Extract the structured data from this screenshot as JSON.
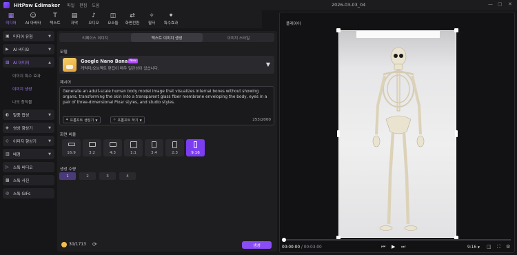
{
  "app": {
    "title": "HitPaw Edimakor",
    "menu": [
      "파일",
      "편집",
      "도움"
    ],
    "datetime": "2026-03-03_04"
  },
  "toolbar": [
    {
      "label": "미디어",
      "icon": "▦",
      "active": true
    },
    {
      "label": "AI 아바타",
      "icon": "☺",
      "active": false
    },
    {
      "label": "텍스트",
      "icon": "T",
      "active": false
    },
    {
      "label": "자막",
      "icon": "▤",
      "active": false
    },
    {
      "label": "오디오",
      "icon": "♪",
      "active": false
    },
    {
      "label": "요소들",
      "icon": "◫",
      "active": false
    },
    {
      "label": "화면전환",
      "icon": "⇄",
      "active": false
    },
    {
      "label": "필터",
      "icon": "✧",
      "active": false
    },
    {
      "label": "특수효과",
      "icon": "✦",
      "active": false
    }
  ],
  "sidebar": {
    "items": [
      {
        "label": "미디어 유형",
        "icon": "▣"
      },
      {
        "label": "AI 비디오",
        "icon": "▶"
      },
      {
        "label": "AI 이미지",
        "icon": "▨",
        "active": true
      },
      {
        "label": "이미지 특수 효과",
        "sub": true
      },
      {
        "label": "이미지 생성",
        "sub": true,
        "active": true
      },
      {
        "label": "나의 창작물",
        "sub": true
      },
      {
        "label": "말풍 합성",
        "icon": "◐"
      },
      {
        "label": "영상 향상기",
        "icon": "◈"
      },
      {
        "label": "이미지 향상기",
        "icon": "◇"
      },
      {
        "label": "배경",
        "icon": "▥"
      },
      {
        "label": "스톡 비디오",
        "icon": "▷"
      },
      {
        "label": "스톡 사진",
        "icon": "▩"
      },
      {
        "label": "스톡 GIFs",
        "icon": "◎"
      }
    ]
  },
  "panel": {
    "tabs": [
      {
        "label": "리페이스 이미지",
        "active": false
      },
      {
        "label": "텍스트 이미지 생성",
        "active": true
      },
      {
        "label": "이미지 스타일",
        "active": false
      }
    ],
    "model_label": "모델",
    "model_name": "Google Nano Banana",
    "model_badge": "New",
    "model_desc": "캐릭터/오브젝트 편집이 매우 일관성이 있습니다.",
    "prompt_label": "제시어",
    "prompt_text": "Generate an adult-scale human body model image that visualizes internal bones without showing organs, transforming the skin into a transparent glass fiber membrane enveloping the body, eyes in a pair of three-dimensional Pixar styles, and studio styles.",
    "prompt_btn1": "프롬프트 생성기",
    "prompt_btn2": "프롬프트 하기",
    "char_count": "253/2000",
    "ratio_label": "화면 비율",
    "ratios": [
      {
        "label": "16:9",
        "w": 16,
        "h": 9
      },
      {
        "label": "3:2",
        "w": 3,
        "h": 2
      },
      {
        "label": "4:3",
        "w": 4,
        "h": 3
      },
      {
        "label": "1:1",
        "w": 1,
        "h": 1
      },
      {
        "label": "3:4",
        "w": 3,
        "h": 4
      },
      {
        "label": "2:3",
        "w": 2,
        "h": 3
      },
      {
        "label": "9:16",
        "w": 9,
        "h": 16,
        "active": true
      }
    ],
    "count_label": "생성 수량",
    "counts": [
      {
        "label": "1",
        "active": true
      },
      {
        "label": "2"
      },
      {
        "label": "3"
      },
      {
        "label": "4"
      }
    ],
    "credits": "30/1713",
    "generate_label": "생성"
  },
  "player": {
    "title": "플레이어",
    "time_current": "00:00:00",
    "time_total": "00:03:00",
    "aspect": "9:16"
  },
  "colors": {
    "accent": "#8a4cf5",
    "accent_text": "#a77bff"
  }
}
